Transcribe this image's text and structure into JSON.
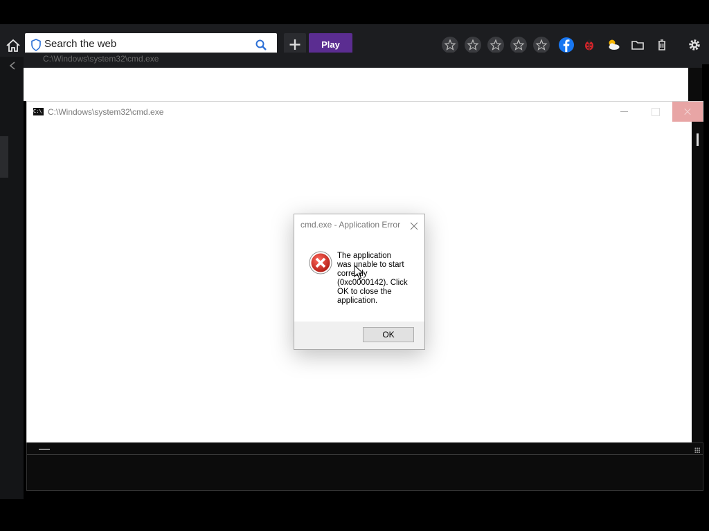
{
  "browser": {
    "search_placeholder": "Search the web",
    "play_label": "Play",
    "icons": [
      "home-icon",
      "shield-icon",
      "search-icon",
      "plus-icon",
      "star-icon",
      "star-icon",
      "star-icon",
      "star-icon",
      "star-icon",
      "facebook-icon",
      "ladybug-icon",
      "weather-icon",
      "folder-icon",
      "trash-icon",
      "gear-icon"
    ],
    "colors": {
      "toolbar": "#1c1d20",
      "play": "#5b2d91",
      "facebook": "#1877f2"
    }
  },
  "background_window": {
    "title": "C:\\Windows\\system32\\cmd.exe"
  },
  "main_window": {
    "title": "C:\\Windows\\system32\\cmd.exe"
  },
  "dialog": {
    "title": "cmd.exe - Application Error",
    "message_lines": [
      "The application",
      "was unable to start",
      "correctly",
      "(0xc0000142). Click",
      "OK to close the",
      "application."
    ],
    "ok_label": "OK",
    "error_color": "#c42b1c"
  }
}
